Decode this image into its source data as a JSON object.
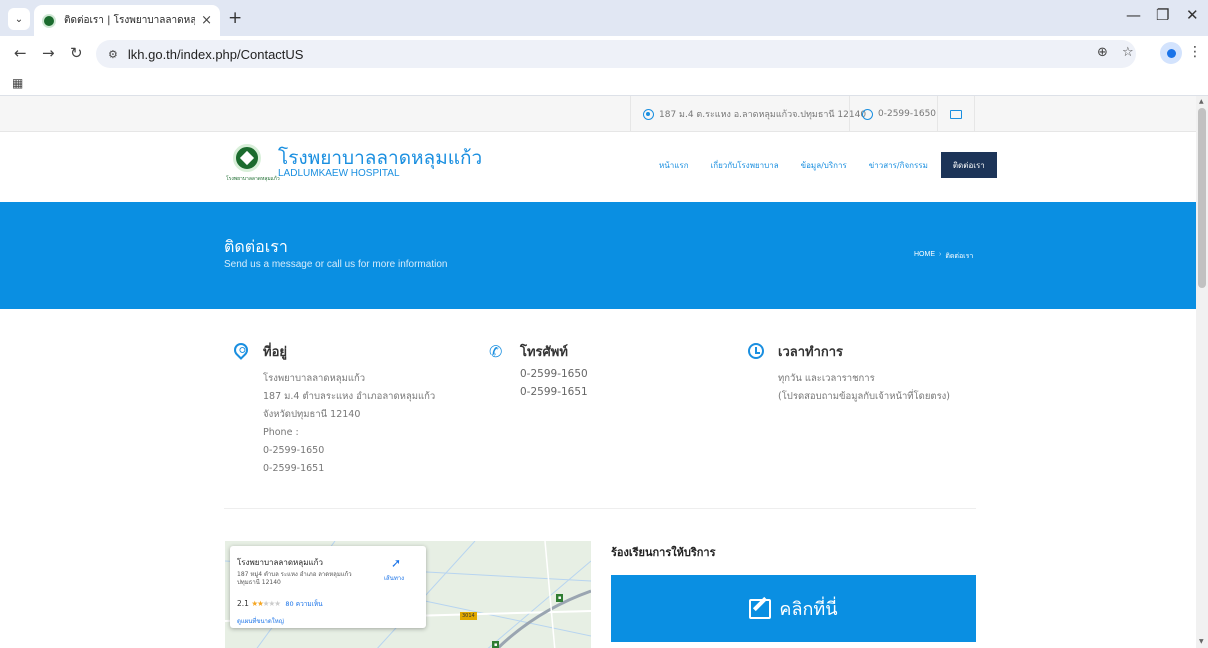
{
  "browser": {
    "tab_title": "ติดต่อเรา | โรงพยาบาลลาดหลุมแก้ว",
    "url": "lkh.go.th/index.php/ContactUS",
    "site_info_icon": "tune-icon"
  },
  "topbar": {
    "address": "187 ม.4 ต.ระแหง อ.ลาดหลุมแก้วจ.ปทุมธานี 12140",
    "phone": "0-2599-1650"
  },
  "header": {
    "logo_name_th": "โรงพยาบาลลาดหลุมแก้ว",
    "logo_name_en": "LADLUMKAEW HOSPITAL",
    "logo_small_text": "โรงพยาบาลลาดหลุมแก้ว",
    "nav": [
      {
        "label": "หน้าแรก"
      },
      {
        "label": "เกี่ยวกับโรงพยาบาล"
      },
      {
        "label": "ข้อมูล/บริการ"
      },
      {
        "label": "ข่าวสาร/กิจกรรม"
      },
      {
        "label": "ติดต่อเรา"
      }
    ]
  },
  "hero": {
    "title": "ติดต่อเรา",
    "subtitle": "Send us a message or call us for more information",
    "crumb_home": "HOME",
    "crumb_sep": "›",
    "crumb_current": "ติดต่อเรา"
  },
  "address": {
    "heading": "ที่อยู่",
    "lines": [
      "โรงพยาบาลลาดหลุมแก้ว",
      "187 ม.4 ตำบลระแหง อำเภอลาดหลุมแก้ว",
      "จังหวัดปทุมธานี 12140",
      "Phone :",
      "0-2599-1650",
      "0-2599-1651"
    ]
  },
  "phone": {
    "heading": "โทรศัพท์",
    "lines": [
      "0-2599-1650",
      "0-2599-1651"
    ]
  },
  "hours": {
    "heading": "เวลาทำการ",
    "lines": [
      "ทุกวัน และเวลาราชการ",
      "(โปรดสอบถามข้อมูลกับเจ้าหน้าที่โดยตรง)"
    ]
  },
  "map": {
    "place_name": "โรงพยาบาลลาดหลุมแก้ว",
    "address": "187 หมู่4 ตำบล ระแหง อำเภอ ลาดหลุมแก้ว ปทุมธานี 12140",
    "rating": "2.1",
    "stars": "★★★★★",
    "rating_value": 2.1,
    "reviews": "80 ความเห็น",
    "larger_map": "ดูแผนที่ขนาดใหญ่",
    "directions": "เส้นทาง",
    "road_badge": "3014"
  },
  "complaint": {
    "title": "ร้องเรียนการให้บริการ",
    "button": "คลิกที่นี่"
  },
  "colors": {
    "accent": "#0a8fe2",
    "nav_active": "#1c3458",
    "logo_green": "#1b6b2e"
  }
}
